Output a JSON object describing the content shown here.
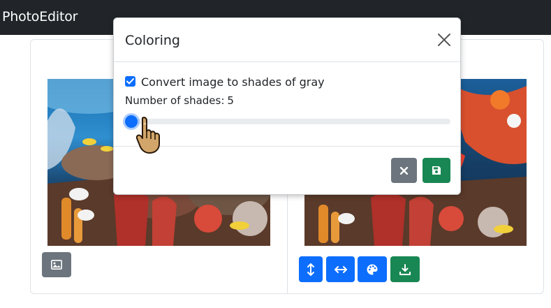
{
  "navbar": {
    "brand": "PhotoEditor"
  },
  "left_panel": {
    "image_alt": "coral reef photo",
    "buttons": [
      {
        "icon": "image-icon",
        "color": "#6c757d"
      }
    ]
  },
  "right_panel": {
    "image_alt": "coral reef photo",
    "buttons": [
      {
        "icon": "flip-vertical-icon",
        "color": "#0d6efd"
      },
      {
        "icon": "flip-horizontal-icon",
        "color": "#0d6efd"
      },
      {
        "icon": "palette-icon",
        "color": "#0d6efd"
      },
      {
        "icon": "download-icon",
        "color": "#198754"
      }
    ]
  },
  "modal": {
    "title": "Coloring",
    "close_icon": "close-icon",
    "grayscale_checkbox": {
      "label": "Convert image to shades of gray",
      "checked": true
    },
    "shades": {
      "label": "Number of shades:",
      "value": "5",
      "slider_fraction": 0.02
    },
    "footer_buttons": [
      {
        "icon": "close-icon",
        "color": "#6c757d"
      },
      {
        "icon": "save-icon",
        "color": "#198754"
      }
    ]
  },
  "colors": {
    "primary": "#0d6efd",
    "secondary": "#6c757d",
    "success": "#198754",
    "navbar": "#212529"
  }
}
